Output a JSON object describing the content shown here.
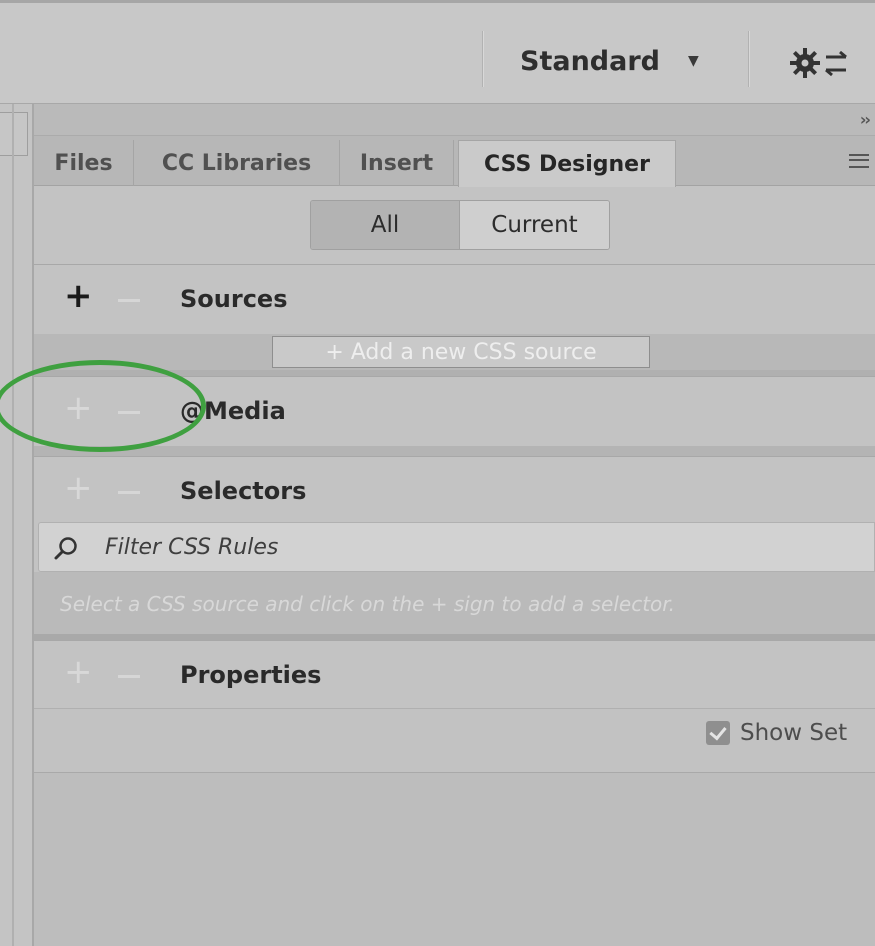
{
  "toolbar": {
    "workspace_label": "Standard",
    "caret_icon": "caret-down-icon",
    "settings_icon": "gear-sync-icon"
  },
  "panel": {
    "collapse_label": "››",
    "tabs": [
      {
        "label": "Files",
        "active": false
      },
      {
        "label": "CC Libraries",
        "active": false
      },
      {
        "label": "Insert",
        "active": false
      },
      {
        "label": "CSS Designer",
        "active": true
      }
    ],
    "view_toggle": {
      "all_label": "All",
      "current_label": "Current",
      "selected": "All"
    },
    "sections": {
      "sources": {
        "title": "Sources",
        "plus_active": true,
        "add_source_label": "+ Add a new CSS source"
      },
      "media": {
        "title": "@Media"
      },
      "selectors": {
        "title": "Selectors",
        "filter_placeholder": "Filter CSS Rules",
        "hint": "Select a CSS source and click on the + sign to add a selector."
      },
      "properties": {
        "title": "Properties",
        "show_set_label": "Show Set",
        "show_set_checked": true
      }
    }
  },
  "annotation_color": "#3fa040"
}
